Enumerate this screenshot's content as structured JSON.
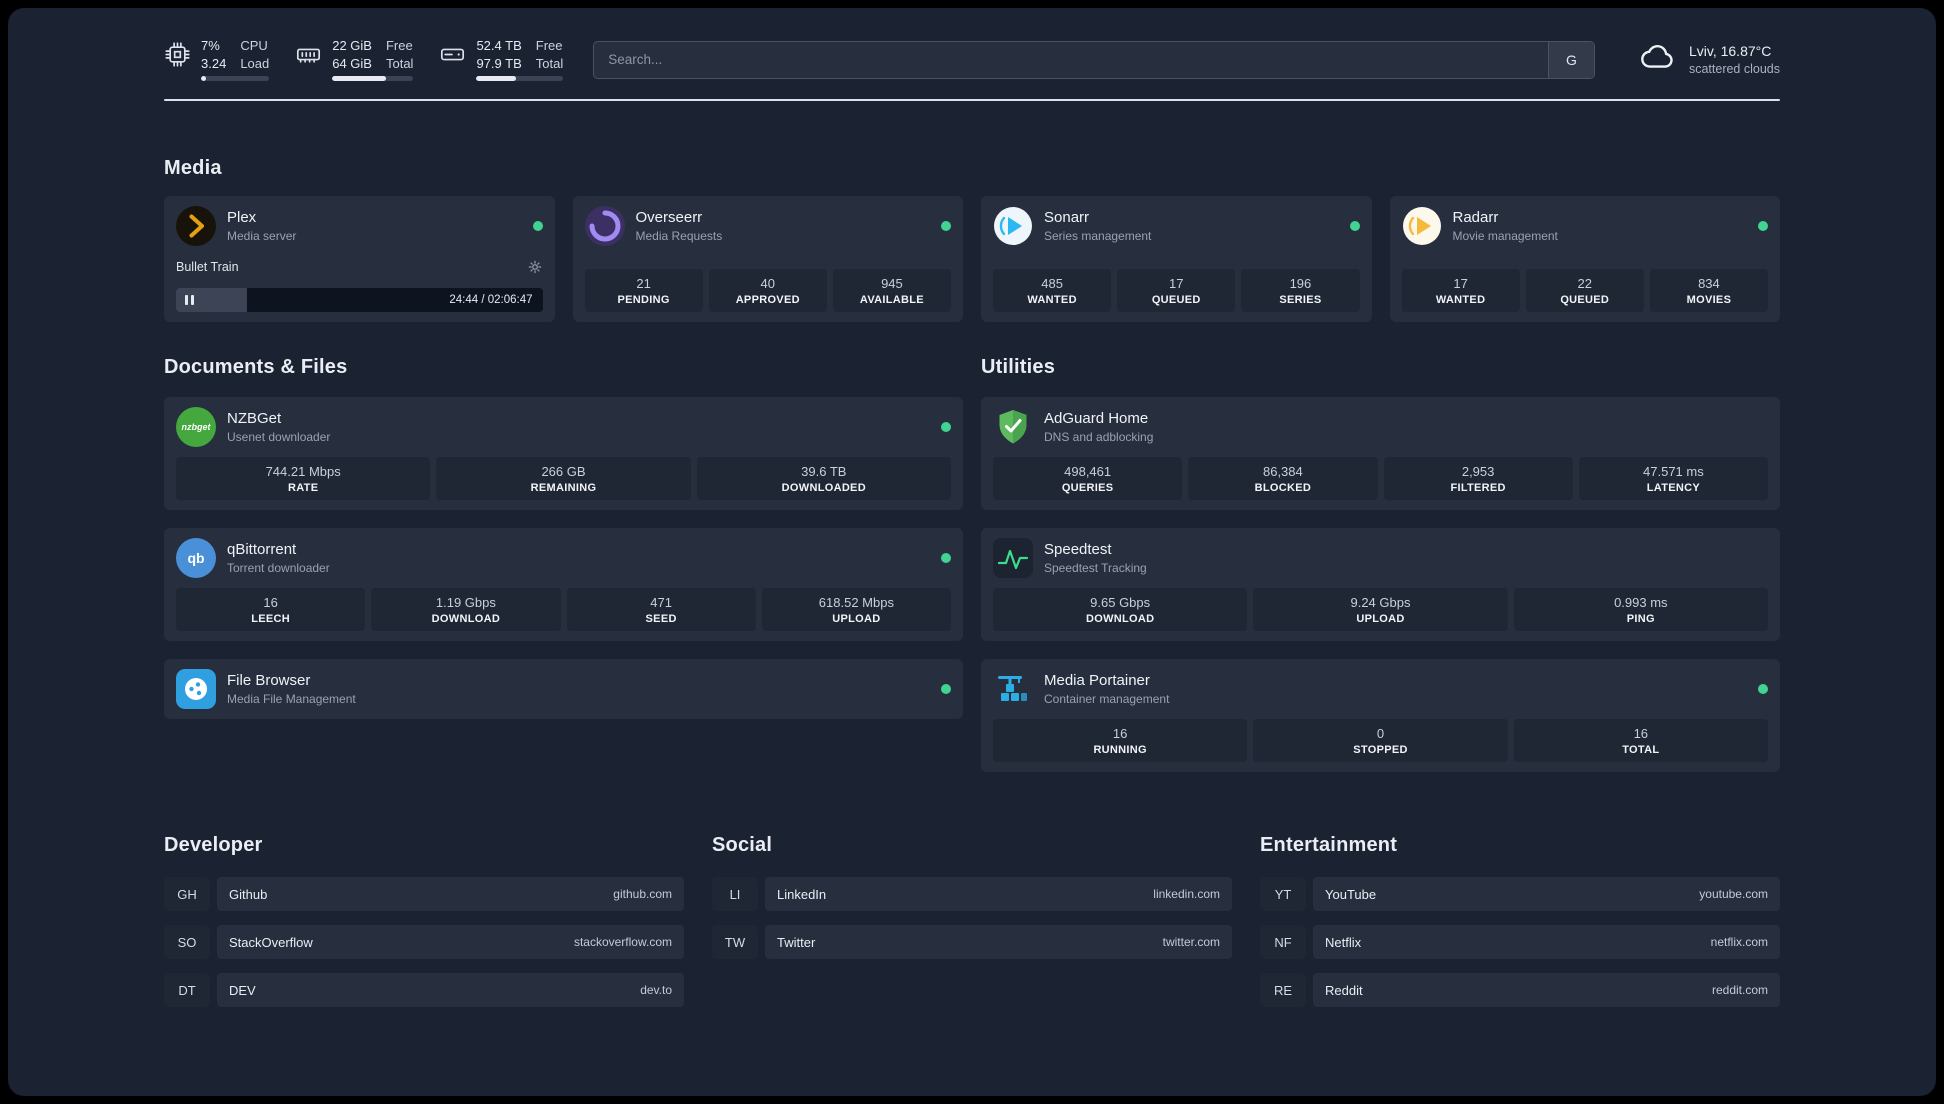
{
  "colors": {
    "status_online": "#41d392",
    "page_bg": "#1b2231",
    "card_bg": "#272e3d",
    "plex_amber": "#e5a00d",
    "speedtest_green": "#3ddc8e",
    "portainer_blue": "#2caee4"
  },
  "icons": {
    "cpu": "cpu-chip-icon",
    "memory": "ram-icon",
    "disk": "hard-drive-icon",
    "weather": "cloud-icon",
    "settings": "gear-icon",
    "pause": "pause-icon",
    "search_provider": "google-shortcut"
  },
  "header": {
    "cpu": {
      "percent": "7%",
      "load": "3.24",
      "label_top": "CPU",
      "label_bottom": "Load",
      "bar_pct": 7
    },
    "memory": {
      "free": "22 GiB",
      "total": "64 GiB",
      "label_top": "Free",
      "label_bottom": "Total",
      "bar_pct": 66
    },
    "disk": {
      "free": "52.4 TB",
      "total": "97.9 TB",
      "label_top": "Free",
      "label_bottom": "Total",
      "bar_pct": 46
    },
    "search": {
      "placeholder": "Search...",
      "provider": "G"
    },
    "weather": {
      "location": "Lviv, 16.87°C",
      "condition": "scattered clouds"
    }
  },
  "media": {
    "title": "Media",
    "plex": {
      "name": "Plex",
      "desc": "Media server",
      "now_playing": "Bullet Train",
      "time": "24:44 / 02:06:47",
      "progress_pct": 19.5
    },
    "overseerr": {
      "name": "Overseerr",
      "desc": "Media Requests",
      "stats": [
        {
          "value": "21",
          "label": "PENDING"
        },
        {
          "value": "40",
          "label": "APPROVED"
        },
        {
          "value": "945",
          "label": "AVAILABLE"
        }
      ]
    },
    "sonarr": {
      "name": "Sonarr",
      "desc": "Series management",
      "stats": [
        {
          "value": "485",
          "label": "WANTED"
        },
        {
          "value": "17",
          "label": "QUEUED"
        },
        {
          "value": "196",
          "label": "SERIES"
        }
      ]
    },
    "radarr": {
      "name": "Radarr",
      "desc": "Movie management",
      "stats": [
        {
          "value": "17",
          "label": "WANTED"
        },
        {
          "value": "22",
          "label": "QUEUED"
        },
        {
          "value": "834",
          "label": "MOVIES"
        }
      ]
    }
  },
  "documents": {
    "title": "Documents & Files",
    "nzbget": {
      "name": "NZBGet",
      "desc": "Usenet downloader",
      "stats": [
        {
          "value": "744.21 Mbps",
          "label": "RATE"
        },
        {
          "value": "266 GB",
          "label": "REMAINING"
        },
        {
          "value": "39.6 TB",
          "label": "DOWNLOADED"
        }
      ]
    },
    "qbittorrent": {
      "name": "qBittorrent",
      "desc": "Torrent downloader",
      "stats": [
        {
          "value": "16",
          "label": "LEECH"
        },
        {
          "value": "1.19 Gbps",
          "label": "DOWNLOAD"
        },
        {
          "value": "471",
          "label": "SEED"
        },
        {
          "value": "618.52 Mbps",
          "label": "UPLOAD"
        }
      ]
    },
    "filebrowser": {
      "name": "File Browser",
      "desc": "Media File Management"
    }
  },
  "utilities": {
    "title": "Utilities",
    "adguard": {
      "name": "AdGuard Home",
      "desc": "DNS and adblocking",
      "stats": [
        {
          "value": "498,461",
          "label": "QUERIES"
        },
        {
          "value": "86,384",
          "label": "BLOCKED"
        },
        {
          "value": "2,953",
          "label": "FILTERED"
        },
        {
          "value": "47.571 ms",
          "label": "LATENCY"
        }
      ]
    },
    "speedtest": {
      "name": "Speedtest",
      "desc": "Speedtest Tracking",
      "stats": [
        {
          "value": "9.65 Gbps",
          "label": "DOWNLOAD"
        },
        {
          "value": "9.24 Gbps",
          "label": "UPLOAD"
        },
        {
          "value": "0.993 ms",
          "label": "PING"
        }
      ]
    },
    "portainer": {
      "name": "Media Portainer",
      "desc": "Container management",
      "stats": [
        {
          "value": "16",
          "label": "RUNNING"
        },
        {
          "value": "0",
          "label": "STOPPED"
        },
        {
          "value": "16",
          "label": "TOTAL"
        }
      ]
    }
  },
  "bookmarks": {
    "developer": {
      "title": "Developer",
      "items": [
        {
          "abbr": "GH",
          "name": "Github",
          "url": "github.com"
        },
        {
          "abbr": "SO",
          "name": "StackOverflow",
          "url": "stackoverflow.com"
        },
        {
          "abbr": "DT",
          "name": "DEV",
          "url": "dev.to"
        }
      ]
    },
    "social": {
      "title": "Social",
      "items": [
        {
          "abbr": "LI",
          "name": "LinkedIn",
          "url": "linkedin.com"
        },
        {
          "abbr": "TW",
          "name": "Twitter",
          "url": "twitter.com"
        }
      ]
    },
    "entertainment": {
      "title": "Entertainment",
      "items": [
        {
          "abbr": "YT",
          "name": "YouTube",
          "url": "youtube.com"
        },
        {
          "abbr": "NF",
          "name": "Netflix",
          "url": "netflix.com"
        },
        {
          "abbr": "RE",
          "name": "Reddit",
          "url": "reddit.com"
        }
      ]
    }
  }
}
